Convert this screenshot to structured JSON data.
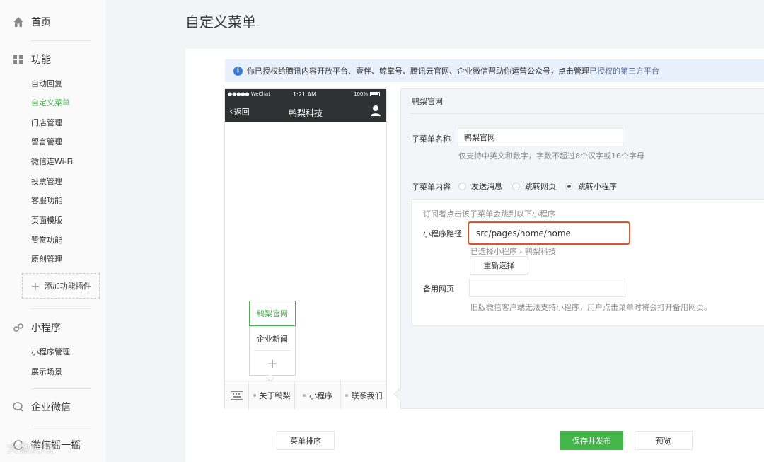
{
  "sidebar": {
    "home_label": "首页",
    "function_label": "功能",
    "function_items": [
      "自动回复",
      "自定义菜单",
      "门店管理",
      "留言管理",
      "微信连Wi-Fi",
      "投票管理",
      "客服功能",
      "页面模版",
      "赞赏功能",
      "原创管理"
    ],
    "active_item": "自定义菜单",
    "add_plugin_label": "添加功能插件",
    "miniprogram_label": "小程序",
    "miniprogram_items": [
      "小程序管理",
      "展示场景"
    ],
    "work_wechat_label": "企业微信",
    "shake_label": "微信摇一摇",
    "watermark": "大数跨境"
  },
  "page_title": "自定义菜单",
  "notice": {
    "text": "你已授权给腾讯内容开放平台、壹伴、鲸掌号、腾讯云官网、企业微信帮助你运营公众号，点击管理",
    "link": "已授权的第三方平台"
  },
  "phone": {
    "carrier": "●●●●● WeChat",
    "time": "1:21 AM",
    "battery": "100%",
    "back_label": "返回",
    "title": "鸭梨科技",
    "submenu": [
      "鸭梨官网",
      "企业新闻"
    ],
    "add_symbol": "+",
    "menu": [
      "关于鸭梨",
      "小程序",
      "联系我们"
    ]
  },
  "editor": {
    "header": "鸭梨官网",
    "name_label": "子菜单名称",
    "name_value": "鸭梨官网",
    "name_hint": "仅支持中英文和数字，字数不超过8个汉字或16个字母",
    "content_label": "子菜单内容",
    "options": [
      "发送消息",
      "跳转网页",
      "跳转小程序"
    ],
    "selected_option": "跳转小程序",
    "subscriber_hint": "订阅者点击该子菜单会跳到以下小程序",
    "path_label": "小程序路径",
    "path_value": "src/pages/home/home",
    "selected_program": "已选择小程序 - 鸭梨科技",
    "reselect_label": "重新选择",
    "backup_label": "备用网页",
    "backup_value": "",
    "backup_hint": "旧版微信客户端无法支持小程序，用户点击菜单时将会打开备用网页。"
  },
  "footer": {
    "sort_label": "菜单排序",
    "publish_label": "保存并发布",
    "preview_label": "预览"
  },
  "colors": {
    "accent": "#44b549",
    "highlight_border": "#e0542b",
    "notice_bg": "#e8f0fb",
    "link": "#576b95"
  }
}
